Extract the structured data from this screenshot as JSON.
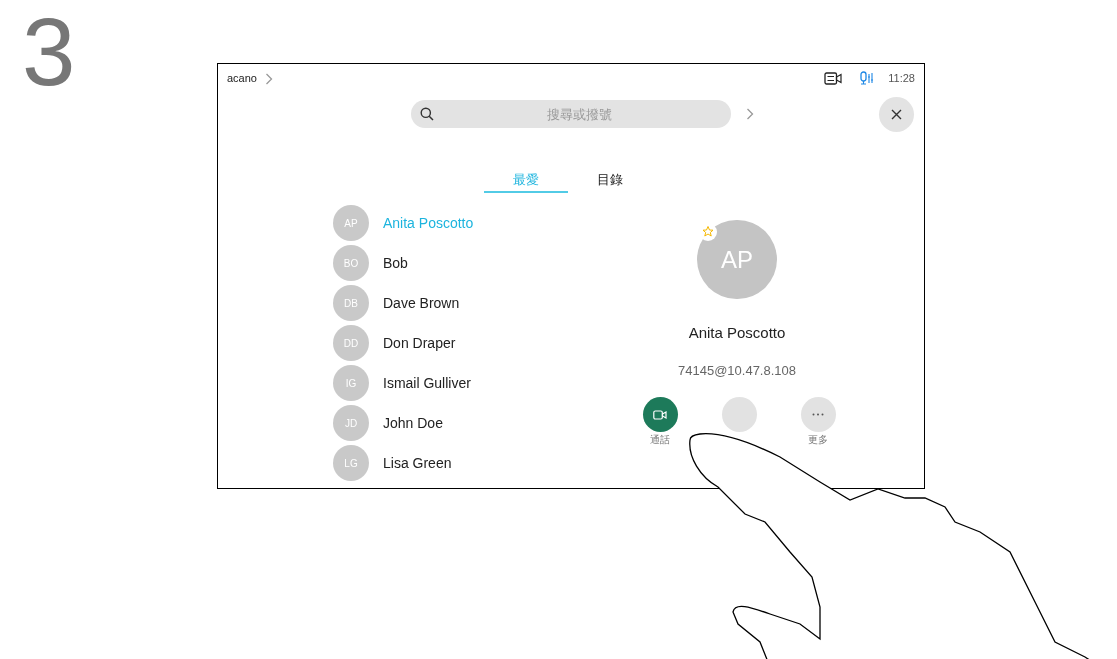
{
  "step": "3",
  "status_bar": {
    "breadcrumb": "acano",
    "time": "11:28",
    "mic_active": true
  },
  "search": {
    "placeholder": "搜尋或撥號"
  },
  "tabs": [
    {
      "label": "最愛",
      "selected": true
    },
    {
      "label": "目錄",
      "selected": false
    }
  ],
  "contacts": [
    {
      "initials": "AP",
      "name": "Anita Poscotto",
      "selected": true
    },
    {
      "initials": "BO",
      "name": "Bob",
      "selected": false
    },
    {
      "initials": "DB",
      "name": "Dave Brown",
      "selected": false
    },
    {
      "initials": "DD",
      "name": "Don Draper",
      "selected": false
    },
    {
      "initials": "IG",
      "name": "Ismail Gulliver",
      "selected": false
    },
    {
      "initials": "JD",
      "name": "John Doe",
      "selected": false
    },
    {
      "initials": "LG",
      "name": "Lisa Green",
      "selected": false
    }
  ],
  "detail": {
    "initials": "AP",
    "favorite": true,
    "name": "Anita Poscotto",
    "address": "74145@10.47.8.108",
    "actions": [
      {
        "kind": "call",
        "label": "通話"
      },
      {
        "kind": "plain"
      },
      {
        "kind": "more",
        "label": "更多"
      }
    ]
  }
}
